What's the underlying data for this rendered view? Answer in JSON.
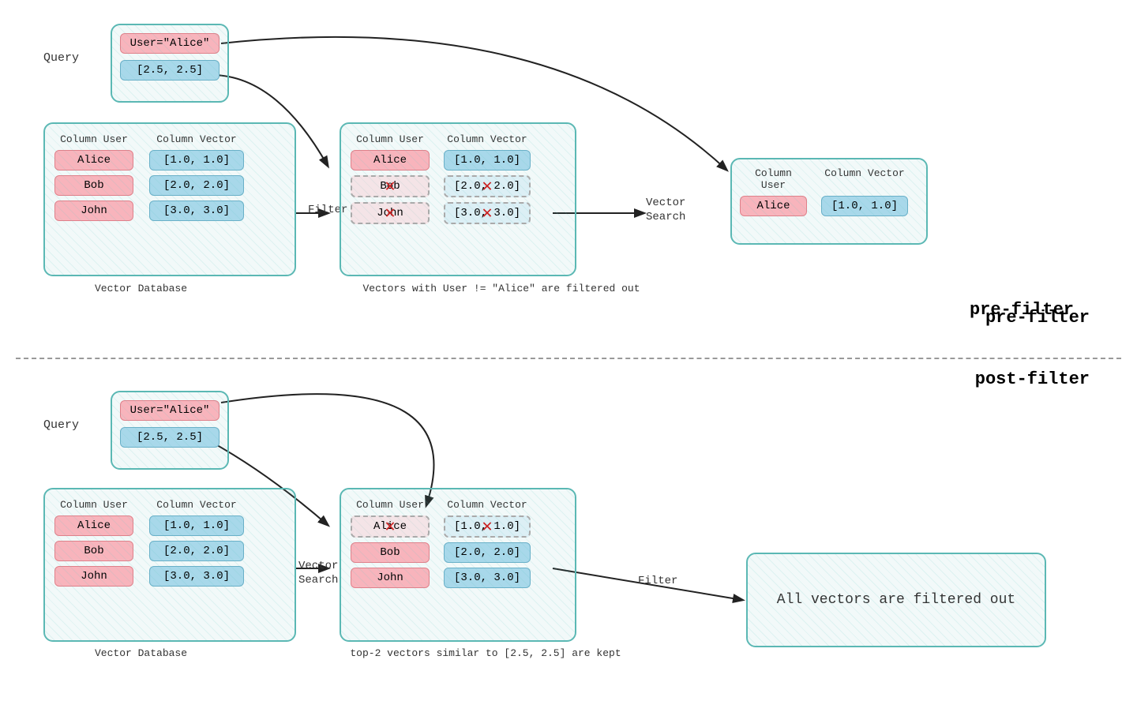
{
  "prefilter": {
    "label": "pre-filter",
    "query_label": "Query",
    "query_user": "User=\"Alice\"",
    "query_vector": "[2.5, 2.5]",
    "db_label": "Vector Database",
    "db_col_user": "Column User",
    "db_col_vector": "Column Vector",
    "db_rows": [
      {
        "user": "Alice",
        "vector": "[1.0, 1.0]"
      },
      {
        "user": "Bob",
        "vector": "[2.0, 2.0]"
      },
      {
        "user": "John",
        "vector": "[3.0, 3.0]"
      }
    ],
    "filtered_col_user": "Column User",
    "filtered_col_vector": "Column Vector",
    "filtered_rows": [
      {
        "user": "Alice",
        "vector": "[1.0, 1.0]",
        "filtered": false
      },
      {
        "user": "Bob",
        "vector": "[2.0, 2.0]",
        "filtered": true
      },
      {
        "user": "John",
        "vector": "[3.0, 3.0]",
        "filtered": true
      }
    ],
    "filter_label": "Filter",
    "filter_caption": "Vectors with User != \"Alice\" are filtered out",
    "result_col_user": "Column User",
    "result_col_vector": "Column Vector",
    "result_rows": [
      {
        "user": "Alice",
        "vector": "[1.0, 1.0]"
      }
    ],
    "vector_search_label": "Vector\nSearch"
  },
  "postfilter": {
    "label": "post-filter",
    "query_label": "Query",
    "query_user": "User=\"Alice\"",
    "query_vector": "[2.5, 2.5]",
    "db_label": "Vector Database",
    "db_col_user": "Column User",
    "db_col_vector": "Column Vector",
    "db_rows": [
      {
        "user": "Alice",
        "vector": "[1.0, 1.0]"
      },
      {
        "user": "Bob",
        "vector": "[2.0, 2.0]"
      },
      {
        "user": "John",
        "vector": "[3.0, 3.0]"
      }
    ],
    "search_result_col_user": "Column User",
    "search_result_col_vector": "Column Vector",
    "search_result_rows": [
      {
        "user": "Alice",
        "vector": "[1.0, 1.0]",
        "filtered": true
      },
      {
        "user": "Bob",
        "vector": "[2.0, 2.0]",
        "filtered": false
      },
      {
        "user": "John",
        "vector": "[3.0, 3.0]",
        "filtered": false
      }
    ],
    "vector_search_label": "Vector\nSearch",
    "filter_label": "Filter",
    "filter_caption": "top-2 vectors similar to [2.5, 2.5] are kept",
    "result_text": "All vectors are filtered out"
  }
}
